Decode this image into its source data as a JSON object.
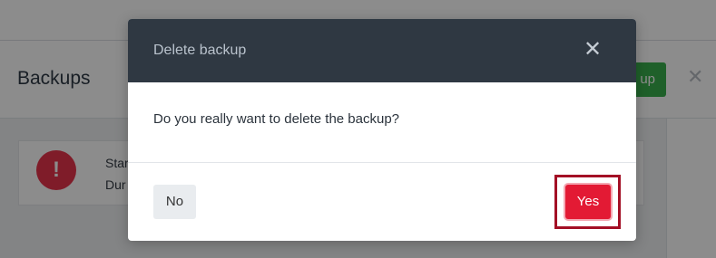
{
  "page": {
    "title": "Backups",
    "create_button_label": "up",
    "card": {
      "line1": "Star",
      "line2": "Dur",
      "status_icon": "exclamation-icon"
    }
  },
  "modal": {
    "title": "Delete backup",
    "message": "Do you really want to delete the backup?",
    "no_label": "No",
    "yes_label": "Yes",
    "close_symbol": "✕"
  },
  "colors": {
    "modal_header": "#2f3842",
    "danger": "#e31a34",
    "success": "#3ab04d"
  }
}
